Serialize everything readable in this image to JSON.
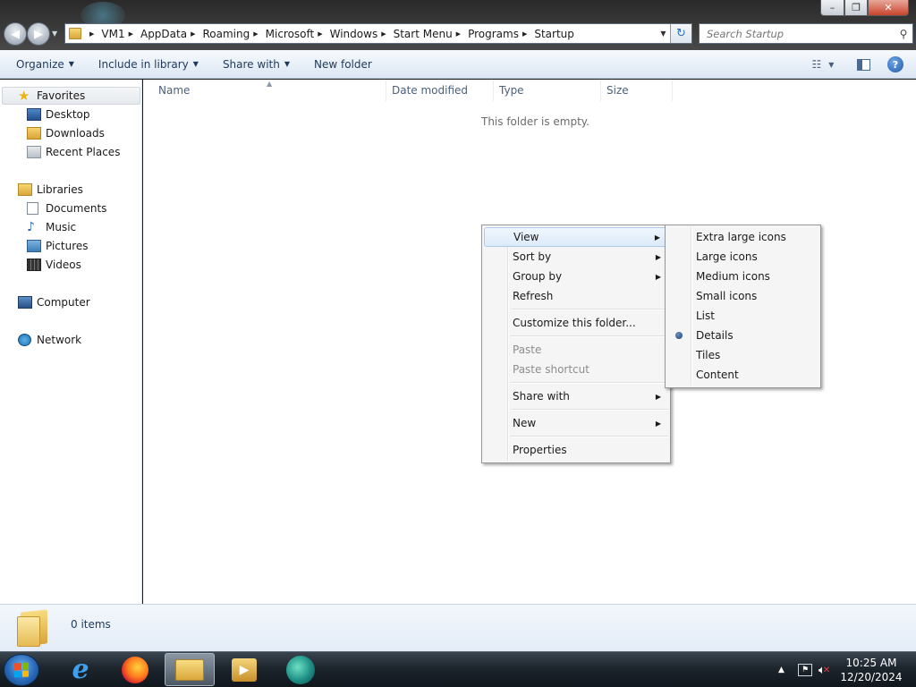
{
  "window": {
    "controls": {
      "minimize": "–",
      "maximize": "❐",
      "close": "✕"
    }
  },
  "address": {
    "crumbs": [
      "VM1",
      "AppData",
      "Roaming",
      "Microsoft",
      "Windows",
      "Start Menu",
      "Programs",
      "Startup"
    ]
  },
  "search": {
    "placeholder": "Search Startup"
  },
  "toolbar": {
    "organize": "Organize",
    "include_in_library": "Include in library",
    "share_with": "Share with",
    "new_folder": "New folder"
  },
  "nav": {
    "favorites": "Favorites",
    "desktop": "Desktop",
    "downloads": "Downloads",
    "recent_places": "Recent Places",
    "libraries": "Libraries",
    "documents": "Documents",
    "music": "Music",
    "pictures": "Pictures",
    "videos": "Videos",
    "computer": "Computer",
    "network": "Network"
  },
  "columns": {
    "name": "Name",
    "date_modified": "Date modified",
    "type": "Type",
    "size": "Size"
  },
  "content": {
    "empty_message": "This folder is empty."
  },
  "context_menu": {
    "view": "View",
    "sort_by": "Sort by",
    "group_by": "Group by",
    "refresh": "Refresh",
    "customize": "Customize this folder...",
    "paste": "Paste",
    "paste_shortcut": "Paste shortcut",
    "share_with": "Share with",
    "new": "New",
    "properties": "Properties"
  },
  "view_submenu": {
    "items": [
      "Extra large icons",
      "Large icons",
      "Medium icons",
      "Small icons",
      "List",
      "Details",
      "Tiles",
      "Content"
    ],
    "selected": "Details"
  },
  "details_pane": {
    "item_count": "0 items"
  },
  "clock": {
    "time": "10:25 AM",
    "date": "12/20/2024"
  },
  "colors": {
    "accent": "#1e395b",
    "close_button": "#c8432b",
    "taskbar": "#1d252d"
  }
}
